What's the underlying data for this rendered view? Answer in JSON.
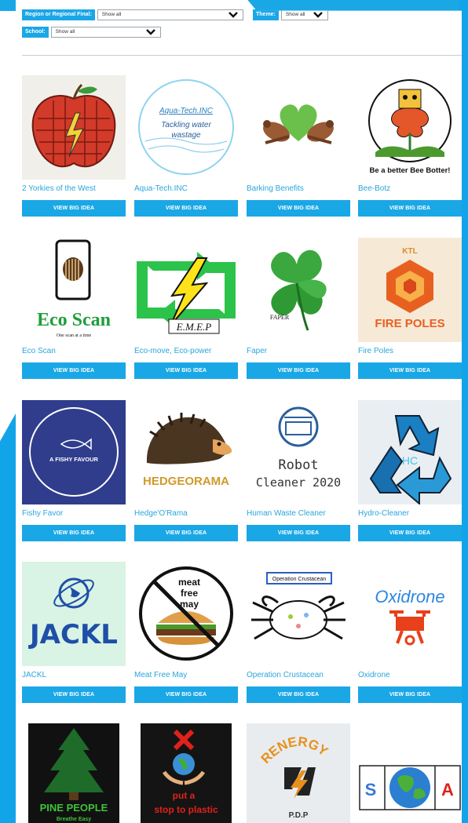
{
  "filters": {
    "region_label": "Region or Regional Final:",
    "region_value": "Show all",
    "theme_label": "Theme:",
    "theme_value": "Show all",
    "school_label": "School:",
    "school_value": "Show all"
  },
  "button_label": "VIEW BIG IDEA",
  "colors": {
    "accent": "#1aa7e6",
    "title_text": "#29a6dc"
  },
  "ideas": [
    {
      "title": "2 Yorkies of the West",
      "icon": "apple-lightning-drawing"
    },
    {
      "title": "Aqua-Tech.INC",
      "icon": "aquatech-circle-logo",
      "logo_line1": "Aqua-Tech.INC",
      "logo_line2": "Tackling water",
      "logo_line3": "wastage"
    },
    {
      "title": "Barking Benefits",
      "icon": "heart-hands-logo"
    },
    {
      "title": "Bee-Botz",
      "icon": "bee-robot-flower-logo",
      "logo_caption": "Be a better Bee Botter!"
    },
    {
      "title": "Eco Scan",
      "icon": "phone-barcode-logo",
      "logo_line1": "Eco Scan",
      "logo_line2": "One scan at a time"
    },
    {
      "title": "Eco-move, Eco-power",
      "icon": "recycle-lightning-logo",
      "logo_caption": "E.M.E.P"
    },
    {
      "title": "Faper",
      "icon": "clover-logo",
      "logo_caption": "FAPER"
    },
    {
      "title": "Fire Poles",
      "icon": "hexagon-cube-logo",
      "logo_line1": "KTL",
      "logo_line2": "FIRE POLES"
    },
    {
      "title": "Fishy Favor",
      "icon": "fish-circle-logo",
      "logo_caption": "A FISHY FAVOUR"
    },
    {
      "title": "Hedge'O'Rama",
      "icon": "hedgehog-logo",
      "logo_caption": "HEDGEORAMA"
    },
    {
      "title": "Human Waste Cleaner",
      "icon": "robot-cleaner-logo",
      "logo_line1": "Robot",
      "logo_line2": "Cleaner 2020"
    },
    {
      "title": "Hydro-Cleaner",
      "icon": "recycle-water-logo",
      "logo_caption": "HC"
    },
    {
      "title": "JACKL",
      "icon": "globe-jackl-logo",
      "logo_caption": "JACKL"
    },
    {
      "title": "Meat Free May",
      "icon": "no-burger-logo",
      "logo_line1": "meat",
      "logo_line2": "free",
      "logo_line3": "may"
    },
    {
      "title": "Operation Crustacean",
      "icon": "crab-logo",
      "logo_caption": "Operation Crustacean"
    },
    {
      "title": "Oxidrone",
      "icon": "drone-logo",
      "logo_caption": "Oxidrone"
    },
    {
      "title": "",
      "icon": "pine-tree-logo",
      "logo_line1": "PINE PEOPLE",
      "logo_line2": "Breathe Easy"
    },
    {
      "title": "",
      "icon": "earth-hands-logo",
      "logo_line1": "put a",
      "logo_line2": "stop to plastic"
    },
    {
      "title": "",
      "icon": "renergy-logo",
      "logo_line1": "RENERGY",
      "logo_line2": "P.D.P"
    },
    {
      "title": "",
      "icon": "puzzle-globe-logo",
      "logo_line1": "S",
      "logo_line2": "A"
    }
  ]
}
